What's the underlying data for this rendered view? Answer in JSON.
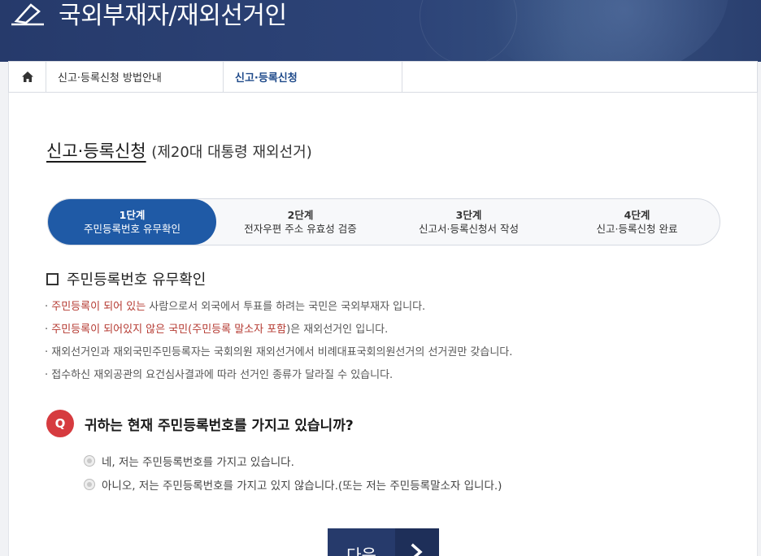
{
  "header": {
    "title": "국외부재자/재외선거인"
  },
  "breadcrumb": {
    "home_icon": "home-icon",
    "items": [
      "신고·등록신청 방법안내",
      "신고·등록신청"
    ]
  },
  "page": {
    "title": "신고·등록신청",
    "subtitle": "(제20대 대통령 재외선거)"
  },
  "steps": [
    {
      "num": "1단계",
      "label": "주민등록번호 유무확인",
      "active": true
    },
    {
      "num": "2단계",
      "label": "전자우편 주소 유효성 검증",
      "active": false
    },
    {
      "num": "3단계",
      "label": "신고서·등록신청서 작성",
      "active": false
    },
    {
      "num": "4단계",
      "label": "신고·등록신청 완료",
      "active": false
    }
  ],
  "section": {
    "heading": "주민등록번호 유무확인",
    "notes": [
      {
        "prefix": "· ",
        "red": "주민등록이 되어 있는",
        "rest": " 사람으로서 외국에서 투표를 하려는 국민은 국외부재자 입니다."
      },
      {
        "prefix": "· ",
        "red": "주민등록이 되어있지 않은 국민",
        "mid": "(",
        "red2": "주민등록 말소자 포함",
        "rest": ")은 재외선거인 입니다."
      },
      {
        "prefix": "· ",
        "text": "재외선거인과 재외국민주민등록자는 국회의원 재외선거에서 비례대표국회의원선거의 선거권만 갖습니다."
      },
      {
        "prefix": "· ",
        "text": "접수하신 재외공관의 요건심사결과에 따라 선거인 종류가 달라질 수 있습니다."
      }
    ]
  },
  "question": {
    "badge": "Q",
    "text": "귀하는 현재 주민등록번호를 가지고 있습니까?",
    "options": [
      "네, 저는 주민등록번호를 가지고 있습니다.",
      "아니오, 저는 주민등록번호를 가지고 있지 않습니다.(또는 저는 주민등록말소자 입니다.)"
    ]
  },
  "next_button": {
    "label": "다음",
    "icon": "chevron-right-icon"
  },
  "colors": {
    "banner": "#263a6b",
    "active_step": "#1f5aa6",
    "accent_red": "#b53a32",
    "q_badge": "#d63b3f"
  }
}
